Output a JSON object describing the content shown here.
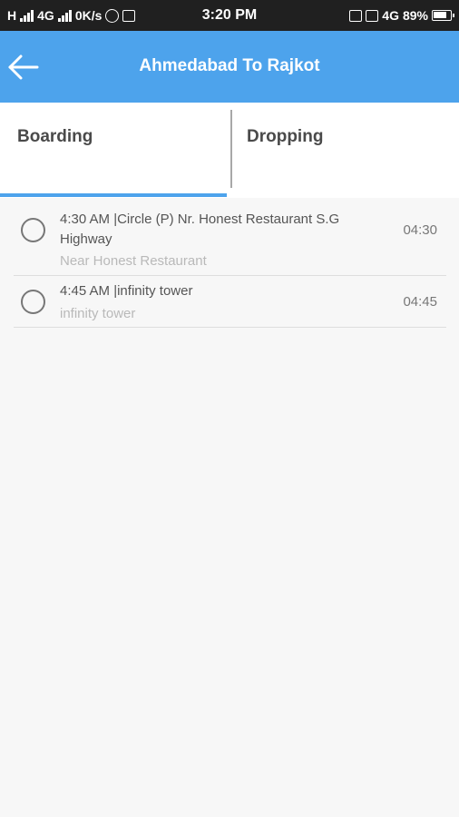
{
  "status_bar": {
    "left_text": "H",
    "network_type": "4G",
    "data_speed": "0K/s",
    "time": "3:20 PM",
    "right_network": "4G",
    "battery": "89%",
    "icons": [
      "signal-icon",
      "whatsapp-icon",
      "notification-icon",
      "vibrate-icon",
      "volte-icon",
      "battery-icon"
    ]
  },
  "app_bar": {
    "title": "Ahmedabad To Rajkot",
    "back_icon": "arrow-left-icon",
    "color": "#4da3ec"
  },
  "tabs": [
    {
      "label": "Boarding",
      "selected": true
    },
    {
      "label": "Dropping",
      "selected": false
    }
  ],
  "stops": [
    {
      "title": "4:30 AM |Circle (P) Nr. Honest Restaurant S.G Highway",
      "subtitle": "Near Honest Restaurant",
      "time": "04:30",
      "selected": false
    },
    {
      "title": "4:45 AM |infinity tower",
      "subtitle": "infinity tower",
      "time": "04:45",
      "selected": false
    }
  ]
}
